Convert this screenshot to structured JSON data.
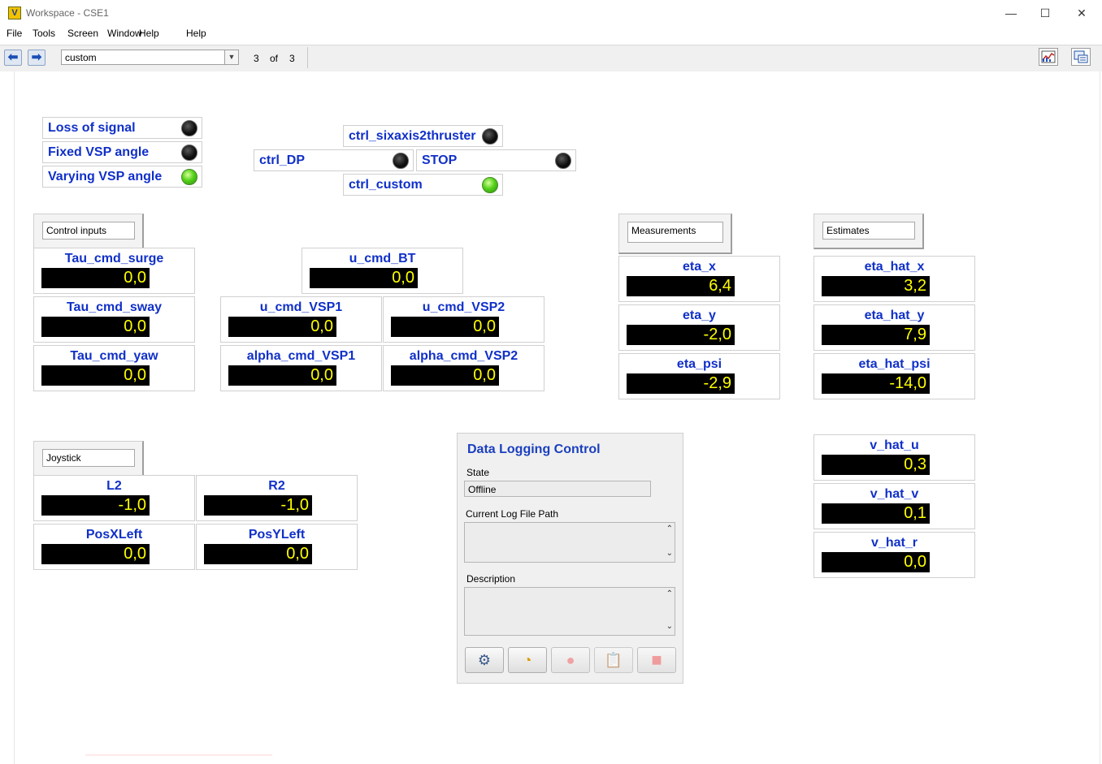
{
  "window": {
    "title": "Workspace - CSE1",
    "icon_label": "V",
    "minimize_glyph": "—",
    "maximize_glyph": "☐",
    "close_glyph": "✕"
  },
  "menu": [
    "File",
    "Tools",
    "Screen",
    "Window",
    "Help"
  ],
  "toolbar": {
    "back_glyph": "⬅",
    "forward_glyph": "➡",
    "screen_select_value": "custom",
    "dropdown_glyph": "▼",
    "page_current": "3",
    "page_of": "of",
    "page_total": "3"
  },
  "status_leds": [
    {
      "label": "Loss of signal",
      "state": "off"
    },
    {
      "label": "Fixed VSP angle",
      "state": "off"
    },
    {
      "label": "Varying VSP angle",
      "state": "on"
    }
  ],
  "controller_leds": {
    "sixaxis": {
      "label": "ctrl_sixaxis2thruster",
      "state": "off"
    },
    "dp": {
      "label": "ctrl_DP",
      "state": "off"
    },
    "stop": {
      "label": "STOP",
      "state": "off"
    },
    "custom": {
      "label": "ctrl_custom",
      "state": "on"
    }
  },
  "groups": {
    "control_inputs": "Control inputs",
    "measurements": "Measurements",
    "estimates": "Estimates",
    "joystick": "Joystick"
  },
  "control_inputs": [
    {
      "label": "Tau_cmd_surge",
      "value": "0,0"
    },
    {
      "label": "Tau_cmd_sway",
      "value": "0,0"
    },
    {
      "label": "Tau_cmd_yaw",
      "value": "0,0"
    }
  ],
  "thruster_cmds": {
    "u_cmd_bt": {
      "label": "u_cmd_BT",
      "value": "0,0"
    },
    "u_cmd_vsp1": {
      "label": "u_cmd_VSP1",
      "value": "0,0"
    },
    "u_cmd_vsp2": {
      "label": "u_cmd_VSP2",
      "value": "0,0"
    },
    "alpha_cmd_vsp1": {
      "label": "alpha_cmd_VSP1",
      "value": "0,0"
    },
    "alpha_cmd_vsp2": {
      "label": "alpha_cmd_VSP2",
      "value": "0,0"
    }
  },
  "measurements": [
    {
      "label": "eta_x",
      "value": "6,4"
    },
    {
      "label": "eta_y",
      "value": "-2,0"
    },
    {
      "label": "eta_psi",
      "value": "-2,9"
    }
  ],
  "estimates": [
    {
      "label": "eta_hat_x",
      "value": "3,2"
    },
    {
      "label": "eta_hat_y",
      "value": "7,9"
    },
    {
      "label": "eta_hat_psi",
      "value": "-14,0"
    }
  ],
  "velocities": [
    {
      "label": "v_hat_u",
      "value": "0,3"
    },
    {
      "label": "v_hat_v",
      "value": "0,1"
    },
    {
      "label": "v_hat_r",
      "value": "0,0"
    }
  ],
  "joystick": [
    {
      "label": "L2",
      "value": "-1,0"
    },
    {
      "label": "R2",
      "value": "-1,0"
    },
    {
      "label": "PosXLeft",
      "value": "0,0"
    },
    {
      "label": "PosYLeft",
      "value": "0,0"
    }
  ],
  "data_logging": {
    "title": "Data Logging Control",
    "state_label": "State",
    "state_value": "Offline",
    "log_path_label": "Current Log File Path",
    "log_path_value": "",
    "description_label": "Description",
    "description_value": "",
    "scroll_up_glyph": "⌃",
    "scroll_down_glyph": "⌄",
    "buttons": {
      "settings_glyph": "⚙",
      "schedule_glyph": "◔",
      "record_glyph": "●",
      "clipboard_glyph": "📋",
      "stop_glyph": "■"
    }
  },
  "colors": {
    "label_blue": "#1030c8",
    "display_yellow": "#ffff00",
    "led_green": "#55d21a",
    "record_red": "#f08080"
  }
}
